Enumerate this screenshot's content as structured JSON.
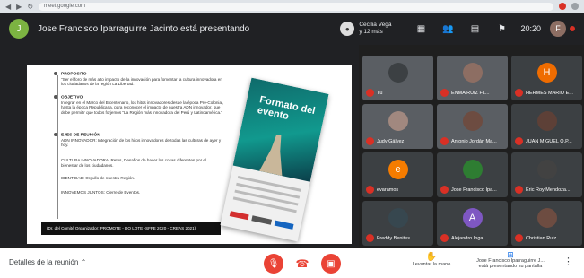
{
  "browser": {
    "url": "meet.google.com"
  },
  "topbar": {
    "presenter_initial": "J",
    "title": "Jose Francisco Iparraguirre Jacinto está presentando",
    "guest_name": "Cecilia Vega",
    "guest_sub": "y 12 más",
    "clock": "20:20",
    "me_initial": "F"
  },
  "slide": {
    "sections": [
      {
        "heading": "PROPOSITO",
        "text": "\"Ser el foro de más alto impacto de la innovación para fomentar la cultura innovadora en los ciudadanos de la región La Libertad.\""
      },
      {
        "heading": "OBJETIVO",
        "text": "Integrar en el Marco del Bicentenario, los hitos innovadores desde la época Pre-Colonial, hasta la época Republicana, para reconocer el impacto de nuestra ADN innovador, que debe permitir que todos forjemos \"La Región más innovadora del Perú y Latinoamérica.\""
      },
      {
        "heading": "EJES DE REUNIÓN",
        "text": "ADN INNOVADOR: Integración de los hitos innovadores de todas las culturas de ayer y hoy."
      },
      {
        "heading": "",
        "text": "CULTURA INNOVADORA: Retos, Desafíos de hacer las cosas diferentes por el bienestar de los ciudadanos."
      },
      {
        "heading": "",
        "text": "IDENTIDAD: Orgullo de nuestra Región."
      },
      {
        "heading": "",
        "text": "INNOVEMOS JUNTOS: Cierre de Eventos."
      }
    ],
    "caption": "(Dr. del Comité Organizador: PROMOTE - DO LOTE -SFFE 2020 - CREAS 2021)",
    "book_title": "Formato del evento"
  },
  "participants": [
    {
      "name": "Tú",
      "initial": "",
      "color": "#3c4043",
      "video": true,
      "muted": true
    },
    {
      "name": "ENMA RUIZ FL...",
      "initial": "",
      "color": "#8d6e63",
      "video": true,
      "muted": true
    },
    {
      "name": "HERMES MARIO E...",
      "initial": "H",
      "color": "#ef6c00",
      "video": false,
      "muted": true
    },
    {
      "name": "Judy Gálvez",
      "initial": "",
      "color": "#a1887f",
      "video": true,
      "muted": true
    },
    {
      "name": "Antonio Jordán Ma...",
      "initial": "",
      "color": "#6d4c41",
      "video": true,
      "muted": true
    },
    {
      "name": "JUAN MIGUEL Q.P...",
      "initial": "",
      "color": "#5d4037",
      "video": false,
      "muted": true
    },
    {
      "name": "evaramos",
      "initial": "e",
      "color": "#f57c00",
      "video": false,
      "muted": true
    },
    {
      "name": "Jose Francisco Ipa...",
      "initial": "",
      "color": "#2e7d32",
      "video": false,
      "muted": true
    },
    {
      "name": "Eric Roy Mendoza...",
      "initial": "",
      "color": "#424242",
      "video": false,
      "muted": true
    },
    {
      "name": "Freddy Benites",
      "initial": "",
      "color": "#37474f",
      "video": false,
      "muted": true
    },
    {
      "name": "Alejandro Inga",
      "initial": "A",
      "color": "#7e57c2",
      "video": false,
      "muted": true
    },
    {
      "name": "Christian Ruiz",
      "initial": "",
      "color": "#6d4c41",
      "video": false,
      "muted": true
    }
  ],
  "bottombar": {
    "details_label": "Detalles de la reunión",
    "raise_hand_label": "Levantar la mano",
    "present_label": "Jose Francisco Iparraguirre J... está presentando su pantalla",
    "more_label": "⋮"
  },
  "colors": {
    "danger": "#ea4335",
    "accent": "#1a73e8"
  }
}
